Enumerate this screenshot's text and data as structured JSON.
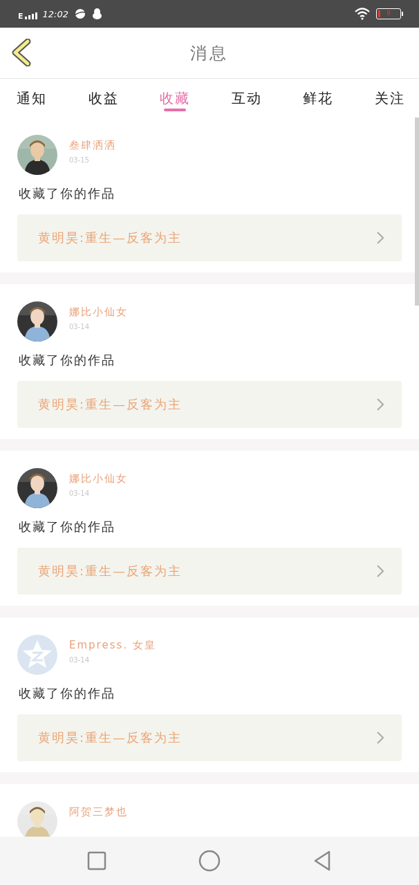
{
  "status_bar": {
    "network": "E",
    "time": "12:02",
    "battery": "9"
  },
  "header": {
    "title": "消息"
  },
  "tabs": [
    {
      "label": "通知",
      "selected": false
    },
    {
      "label": "收益",
      "selected": false
    },
    {
      "label": "收藏",
      "selected": true
    },
    {
      "label": "互动",
      "selected": false
    },
    {
      "label": "鲜花",
      "selected": false
    },
    {
      "label": "关注",
      "selected": false
    }
  ],
  "messages": [
    {
      "user": "叁肆洒洒",
      "date": "03-15",
      "action": "收藏了你的作品",
      "work": "黄明昊:重生—反客为主"
    },
    {
      "user": "娜比小仙女",
      "date": "03-14",
      "action": "收藏了你的作品",
      "work": "黄明昊:重生—反客为主"
    },
    {
      "user": "娜比小仙女",
      "date": "03-14",
      "action": "收藏了你的作品",
      "work": "黄明昊:重生—反客为主"
    },
    {
      "user": "Empress. 女皇",
      "avatar": {
        "kind": "default"
      },
      "date": "03-14",
      "action": "收藏了你的作品",
      "work": "黄明昊:重生—反客为主"
    },
    {
      "user": "阿贺三梦也"
    }
  ]
}
